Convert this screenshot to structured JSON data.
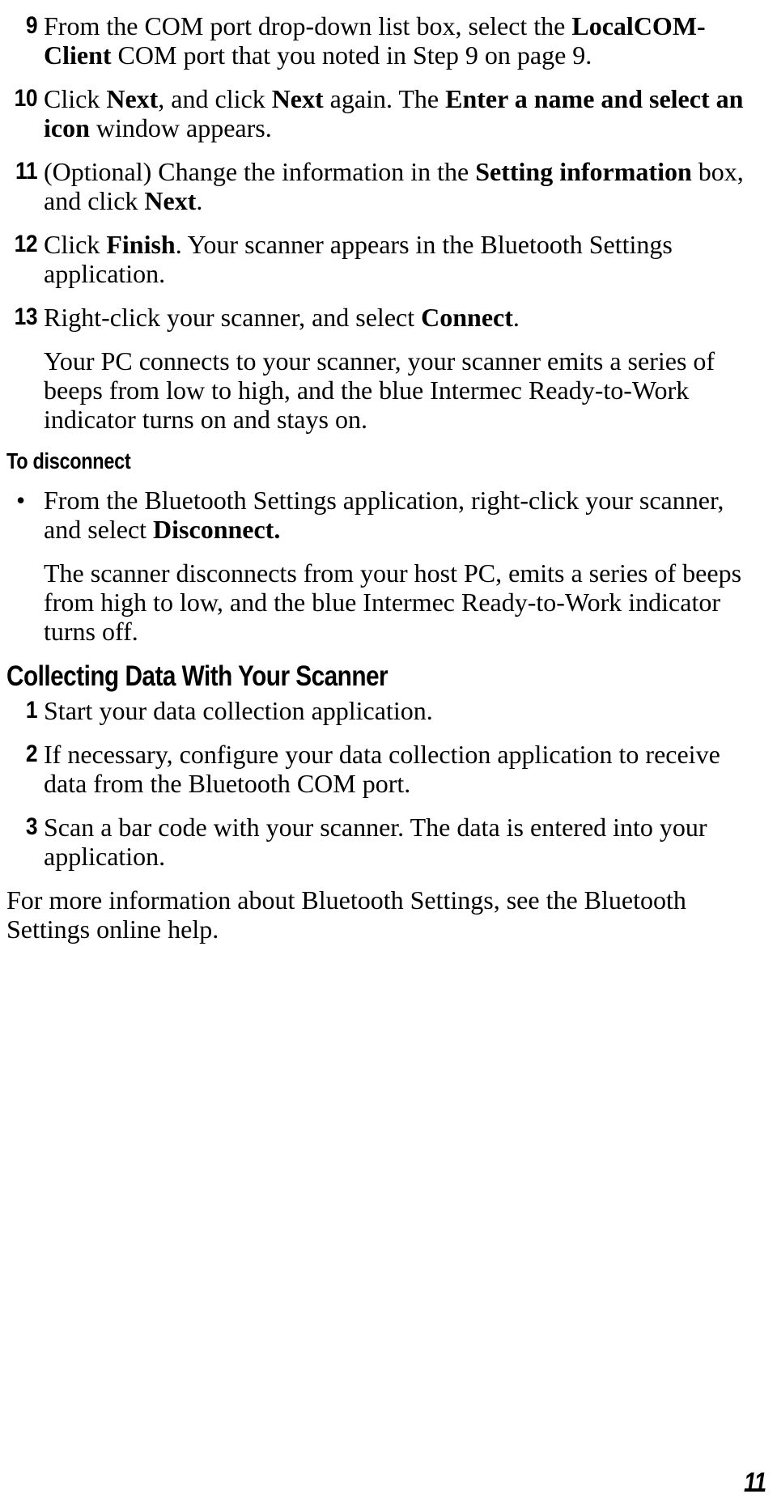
{
  "document": {
    "page_number": "11",
    "blocks": [
      {
        "type": "step",
        "number": "9",
        "segments": [
          {
            "text": "From the COM port drop-down list box, select the ",
            "bold": false
          },
          {
            "text": "LocalCOM-Client",
            "bold": true
          },
          {
            "text": " COM port that you noted in Step 9 on page 9.",
            "bold": false
          }
        ]
      },
      {
        "type": "step",
        "number": "10",
        "segments": [
          {
            "text": "Click ",
            "bold": false
          },
          {
            "text": "Next",
            "bold": true
          },
          {
            "text": ", and click ",
            "bold": false
          },
          {
            "text": "Next",
            "bold": true
          },
          {
            "text": " again. The ",
            "bold": false
          },
          {
            "text": "Enter a name and select an icon",
            "bold": true
          },
          {
            "text": " window appears.",
            "bold": false
          }
        ]
      },
      {
        "type": "step",
        "number": "11",
        "segments": [
          {
            "text": "(Optional) Change the information in the ",
            "bold": false
          },
          {
            "text": "Setting information",
            "bold": true
          },
          {
            "text": " box, and click ",
            "bold": false
          },
          {
            "text": "Next",
            "bold": true
          },
          {
            "text": ".",
            "bold": false
          }
        ]
      },
      {
        "type": "step",
        "number": "12",
        "segments": [
          {
            "text": "Click ",
            "bold": false
          },
          {
            "text": "Finish",
            "bold": true
          },
          {
            "text": ". Your scanner appears in the Bluetooth Settings application.",
            "bold": false
          }
        ]
      },
      {
        "type": "step",
        "number": "13",
        "segments": [
          {
            "text": "Right-click your scanner, and select ",
            "bold": false
          },
          {
            "text": "Connect",
            "bold": true
          },
          {
            "text": ".",
            "bold": false
          }
        ]
      },
      {
        "type": "paragraph",
        "indented": true,
        "segments": [
          {
            "text": "Your PC connects to your scanner, your scanner emits a series of beeps from low to high, and the blue Intermec Ready-to-Work indicator turns on and stays on.",
            "bold": false
          }
        ]
      },
      {
        "type": "heading-sub",
        "text": "To disconnect"
      },
      {
        "type": "bullet",
        "marker": "•",
        "segments": [
          {
            "text": "From the Bluetooth Settings application, right-click your scanner, and select ",
            "bold": false
          },
          {
            "text": "Disconnect.",
            "bold": true
          }
        ]
      },
      {
        "type": "paragraph",
        "indented": true,
        "segments": [
          {
            "text": "The scanner disconnects from your host PC, emits a series of beeps from high to low, and the blue Intermec Ready-to-Work indicator turns off.",
            "bold": false
          }
        ]
      },
      {
        "type": "heading-main",
        "text": "Collecting Data With Your Scanner"
      },
      {
        "type": "step",
        "number": "1",
        "segments": [
          {
            "text": "Start your data collection application.",
            "bold": false
          }
        ]
      },
      {
        "type": "step",
        "number": "2",
        "segments": [
          {
            "text": "If necessary, configure your data collection application to receive data from the Bluetooth COM port.",
            "bold": false
          }
        ]
      },
      {
        "type": "step",
        "number": "3",
        "segments": [
          {
            "text": "Scan a bar code with your scanner. The data is entered into your application.",
            "bold": false
          }
        ]
      },
      {
        "type": "paragraph",
        "indented": false,
        "segments": [
          {
            "text": "For more information about Bluetooth Settings, see the Bluetooth Settings online help.",
            "bold": false
          }
        ]
      }
    ]
  }
}
